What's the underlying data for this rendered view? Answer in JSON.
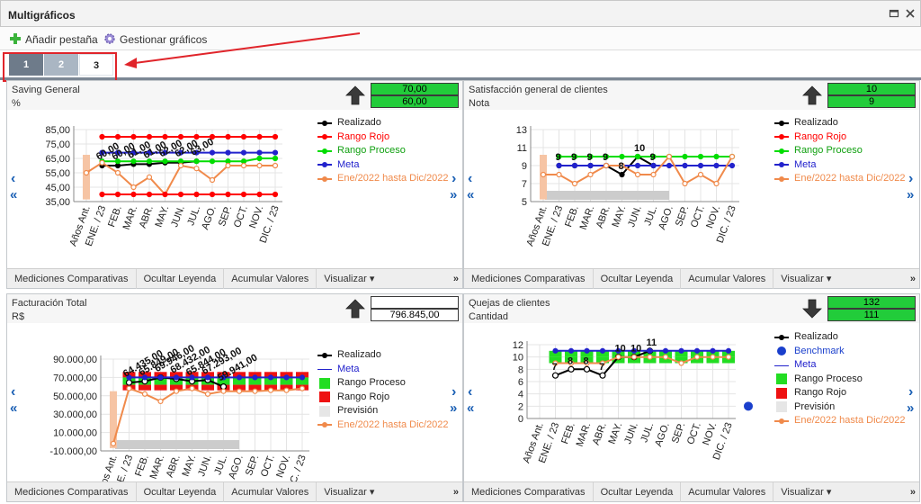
{
  "window": {
    "title": "Multigráficos",
    "restore_icon": "restore-icon",
    "close_icon": "close-icon"
  },
  "toolbar": {
    "add_tab_label": "Añadir pestaña",
    "add_icon": "plus-icon",
    "manage_label": "Gestionar gráficos",
    "manage_icon": "gear-icon"
  },
  "tabs": [
    {
      "label": "1"
    },
    {
      "label": "2"
    },
    {
      "label": "3"
    }
  ],
  "annotation": {
    "color": "#e0242a"
  },
  "footer": {
    "compare": "Mediciones Comparativas",
    "hide_legend": "Ocultar Leyenda",
    "accumulate": "Acumular Valores",
    "visualize": "Visualizar ▾",
    "more": "»"
  },
  "colors": {
    "realizado": "#000000",
    "rojo": "#ff0000",
    "proceso": "#00dd00",
    "meta": "#2222cc",
    "serie": "#f08a4b",
    "green_box": "#22cc3a",
    "prevision": "#cccccc"
  },
  "months": [
    "Años Ant.",
    "ENE. / 23",
    "FEB.",
    "MAR.",
    "ABR.",
    "MAY.",
    "JUN.",
    "JUL.",
    "AGO.",
    "SEP.",
    "OCT.",
    "NOV.",
    "DIC. / 23"
  ],
  "panels": [
    {
      "title": "Saving General",
      "unit": "%",
      "trend": "up",
      "values": [
        "70,00",
        "60,00"
      ],
      "box": "green",
      "legend": [
        {
          "label": "Realizado",
          "kind": "line-dot",
          "color": "#000000"
        },
        {
          "label": "Rango Rojo",
          "kind": "line-dot",
          "color": "#ff0000"
        },
        {
          "label": "Rango Proceso",
          "kind": "line-dot",
          "color": "#00dd00"
        },
        {
          "label": "Meta",
          "kind": "line-dot",
          "color": "#2222cc"
        },
        {
          "label": "Ene/2022 hasta Dic/2022",
          "kind": "line-dot",
          "color": "#f08a4b"
        }
      ],
      "chart_data": {
        "type": "line",
        "y_ticks": [
          "85,00",
          "75,00",
          "65,00",
          "55,00",
          "45,00",
          "35,00"
        ],
        "ylim": [
          35,
          85
        ],
        "point_labels": [
          "60,00",
          "60,00",
          "61,00",
          "61,00",
          "62,00",
          "62,00",
          "63,00"
        ],
        "series": [
          {
            "name": "Realizado",
            "values": [
              null,
              60,
              60,
              61,
              61,
              62,
              62,
              63,
              null,
              null,
              null,
              null,
              null
            ]
          },
          {
            "name": "Rango Rojo",
            "values": [
              null,
              80,
              80,
              80,
              80,
              80,
              80,
              80,
              80,
              80,
              80,
              80,
              80
            ]
          },
          {
            "name": "Rango Proceso",
            "values": [
              null,
              63,
              63,
              63,
              63,
              63,
              63,
              63,
              63,
              63,
              63,
              65,
              65
            ]
          },
          {
            "name": "Meta",
            "values": [
              null,
              69,
              69,
              69,
              69,
              69,
              69,
              69,
              69,
              69,
              69,
              69,
              69
            ]
          },
          {
            "name": "Ene/2022 hasta Dic/2022",
            "values": [
              55,
              62,
              55,
              45,
              52,
              40,
              60,
              58,
              50,
              60,
              60,
              60,
              60
            ]
          },
          {
            "name": "Rango Rojo inferior",
            "values": [
              null,
              40,
              40,
              40,
              40,
              40,
              40,
              40,
              40,
              40,
              40,
              40,
              40
            ]
          }
        ]
      }
    },
    {
      "title": "Satisfacción general de clientes",
      "unit": "Nota",
      "trend": "up",
      "values": [
        "10",
        "9"
      ],
      "box": "green",
      "legend": [
        {
          "label": "Realizado",
          "kind": "line-dot",
          "color": "#000000"
        },
        {
          "label": "Rango Rojo",
          "kind": "line-dot",
          "color": "#ff0000"
        },
        {
          "label": "Rango Proceso",
          "kind": "line-dot",
          "color": "#00dd00"
        },
        {
          "label": "Meta",
          "kind": "line-dot",
          "color": "#2222cc"
        },
        {
          "label": "Ene/2022 hasta Dic/2022",
          "kind": "line-dot",
          "color": "#f08a4b"
        }
      ],
      "chart_data": {
        "type": "line",
        "y_ticks": [
          "13",
          "11",
          "9",
          "7",
          "5"
        ],
        "ylim": [
          5,
          13
        ],
        "point_labels": [
          "9",
          "9",
          "9",
          "9",
          "8",
          "10",
          "9"
        ],
        "series": [
          {
            "name": "Realizado",
            "values": [
              null,
              9,
              9,
              9,
              9,
              8,
              10,
              9,
              null,
              null,
              null,
              null,
              null
            ]
          },
          {
            "name": "Rango Proceso",
            "values": [
              null,
              10,
              10,
              10,
              10,
              10,
              10,
              10,
              10,
              10,
              10,
              10,
              10
            ]
          },
          {
            "name": "Meta",
            "values": [
              null,
              9,
              9,
              9,
              9,
              9,
              9,
              9,
              9,
              9,
              9,
              9,
              9
            ]
          },
          {
            "name": "Ene/2022 hasta Dic/2022",
            "values": [
              8,
              8,
              7,
              8,
              9,
              9,
              8,
              8,
              10,
              7,
              8,
              7,
              10
            ]
          }
        ]
      }
    },
    {
      "title": "Facturación Total",
      "unit": "R$",
      "trend": "up",
      "values": [
        "",
        "796.845,00"
      ],
      "box": "white",
      "legend": [
        {
          "label": "Realizado",
          "kind": "line-dot",
          "color": "#000000"
        },
        {
          "label": "Meta",
          "kind": "line",
          "color": "#2222cc"
        },
        {
          "label": "Rango Proceso",
          "kind": "square",
          "color": "#22dd22"
        },
        {
          "label": "Rango Rojo",
          "kind": "square",
          "color": "#ee1111"
        },
        {
          "label": "Previsión",
          "kind": "square",
          "color": "#e6e6e6"
        },
        {
          "label": "Ene/2022 hasta Dic/2022",
          "kind": "line-dot",
          "color": "#f08a4b"
        }
      ],
      "chart_data": {
        "type": "line",
        "y_ticks": [
          "90.000,00",
          "70.000,00",
          "50.000,00",
          "30.000,00",
          "10.000,00",
          "-10.000,00"
        ],
        "ylim": [
          -10000,
          90000
        ],
        "point_labels": [
          "64.435,00",
          "65.849,00",
          "69.946,00",
          "68.432,00",
          "65.844,00",
          "67.293,00",
          "59.941,00"
        ],
        "series": [
          {
            "name": "Realizado",
            "values": [
              null,
              64435,
              65849,
              69946,
              68432,
              65844,
              67293,
              59941,
              null,
              null,
              null,
              null,
              null
            ]
          },
          {
            "name": "Meta",
            "values": [
              null,
              70000,
              70000,
              70000,
              70000,
              70000,
              70000,
              70000,
              70000,
              70000,
              70000,
              70000,
              70000
            ]
          },
          {
            "name": "Ene/2022 hasta Dic/2022",
            "values": [
              -2000,
              58000,
              52000,
              44000,
              55000,
              58000,
              52000,
              55000,
              55000,
              55000,
              56000,
              56000,
              58000
            ]
          }
        ]
      }
    },
    {
      "title": "Quejas de clientes",
      "unit": "Cantidad",
      "trend": "down",
      "values": [
        "132",
        "111"
      ],
      "box": "green",
      "legend": [
        {
          "label": "Realizado",
          "kind": "line-dot",
          "color": "#000000"
        },
        {
          "label": "Benchmark",
          "kind": "dot",
          "color": "#1a3fcc"
        },
        {
          "label": "Meta",
          "kind": "line",
          "color": "#2222cc"
        },
        {
          "label": "Rango Proceso",
          "kind": "square",
          "color": "#22dd22"
        },
        {
          "label": "Rango Rojo",
          "kind": "square",
          "color": "#ee1111"
        },
        {
          "label": "Previsión",
          "kind": "square",
          "color": "#e6e6e6"
        },
        {
          "label": "Ene/2022 hasta Dic/2022",
          "kind": "line-dot",
          "color": "#f08a4b"
        }
      ],
      "chart_data": {
        "type": "line",
        "y_ticks": [
          "12",
          "10",
          "8",
          "6",
          "4",
          "2",
          "0"
        ],
        "ylim": [
          0,
          12
        ],
        "point_labels": [
          "7",
          "8",
          "8",
          "7",
          "10",
          "10",
          "11"
        ],
        "series": [
          {
            "name": "Realizado",
            "values": [
              null,
              7,
              8,
              8,
              7,
              10,
              10,
              11,
              null,
              null,
              null,
              null,
              null
            ]
          },
          {
            "name": "Meta",
            "values": [
              null,
              11,
              11,
              11,
              11,
              11,
              11,
              11,
              11,
              11,
              11,
              11,
              11
            ]
          },
          {
            "name": "Ene/2022 hasta Dic/2022",
            "values": [
              null,
              9,
              9,
              9,
              9,
              10,
              10,
              10,
              10,
              9,
              10,
              10,
              10
            ]
          },
          {
            "name": "Benchmark",
            "values": [
              2
            ]
          }
        ]
      }
    }
  ]
}
